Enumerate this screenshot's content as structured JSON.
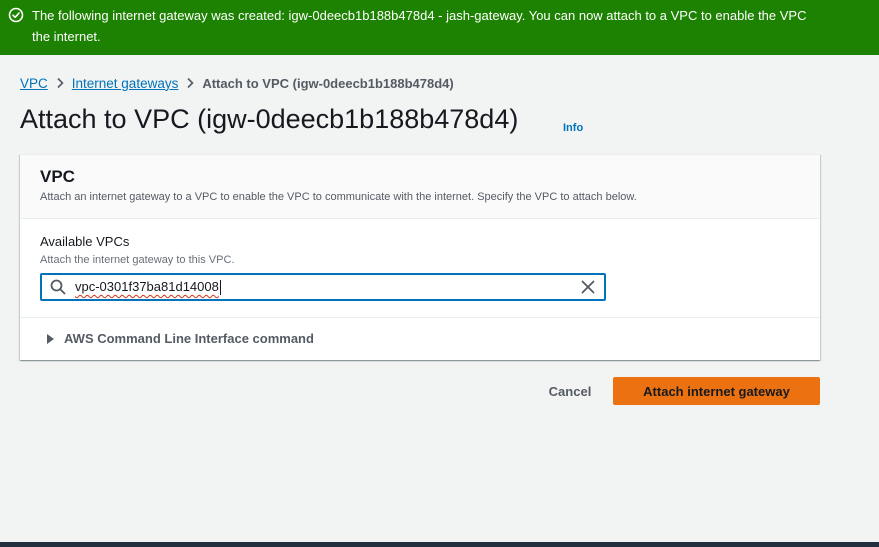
{
  "flash": {
    "line1": "The following internet gateway was created: igw-0deecb1b188b478d4 - jash-gateway. You can now attach to a VPC to enable the VPC",
    "line2": "the internet.",
    "icon": "success-check-icon",
    "color": "#1d8102"
  },
  "breadcrumb": {
    "items": [
      {
        "label": "VPC"
      },
      {
        "label": "Internet gateways"
      }
    ],
    "current": "Attach to VPC (igw-0deecb1b188b478d4)"
  },
  "page": {
    "title": "Attach to VPC (igw-0deecb1b188b478d4)",
    "info_label": "Info"
  },
  "panel": {
    "title": "VPC",
    "description": "Attach an internet gateway to a VPC to enable the VPC to communicate with the internet. Specify the VPC to attach below.",
    "field_label": "Available VPCs",
    "field_description": "Attach the internet gateway to this VPC.",
    "search_value": "vpc-0301f37ba81d14008",
    "cli_label": "AWS Command Line Interface command"
  },
  "actions": {
    "cancel_label": "Cancel",
    "primary_label": "Attach internet gateway",
    "primary_color": "#ec7211"
  },
  "colors": {
    "link": "#0073bb",
    "background": "#f2f3f3"
  }
}
